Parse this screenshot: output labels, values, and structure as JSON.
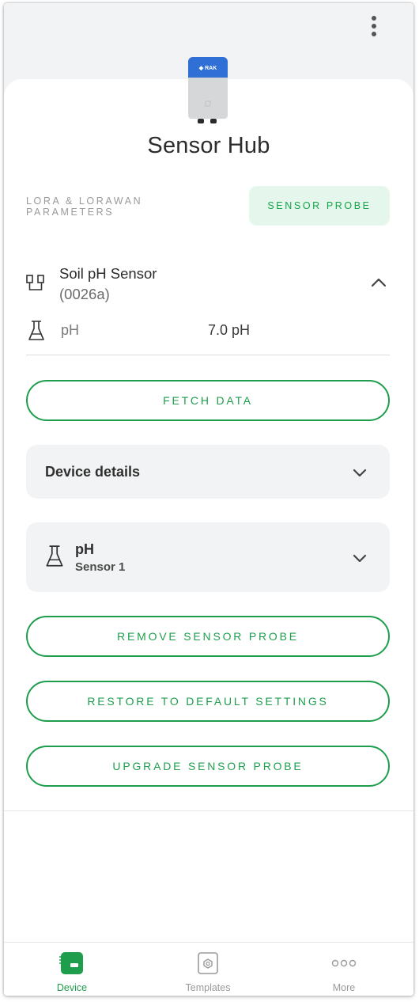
{
  "colors": {
    "accent": "#1e9e4d",
    "tab_active_bg": "#e5f6ec",
    "card_bg": "#f2f3f4",
    "inactive": "#9a9a9a"
  },
  "header": {
    "title": "Sensor Hub",
    "menu_icon": "more-vertical-icon",
    "device_image": "rak-device-icon"
  },
  "tabs": [
    {
      "label": "LORA & LORAWAN PARAMETERS",
      "active": false
    },
    {
      "label": "SENSOR PROBE",
      "active": true
    }
  ],
  "sensor": {
    "name": "Soil pH Sensor",
    "id": "(0026a)",
    "icon": "probe-connector-icon",
    "expanded": true,
    "readings": [
      {
        "icon": "flask-icon",
        "label": "pH",
        "value": "7.0 pH"
      }
    ]
  },
  "actions": {
    "fetch": "FETCH DATA",
    "remove": "REMOVE SENSOR PROBE",
    "restore": "RESTORE TO DEFAULT SETTINGS",
    "upgrade": "UPGRADE SENSOR PROBE"
  },
  "cards": {
    "device_details": {
      "label": "Device details",
      "icon": "chevron-down-icon"
    },
    "ph": {
      "label": "pH",
      "sublabel": "Sensor 1",
      "icon": "flask-icon"
    }
  },
  "bottom_nav": [
    {
      "label": "Device",
      "icon": "device-icon",
      "active": true
    },
    {
      "label": "Templates",
      "icon": "templates-icon",
      "active": false
    },
    {
      "label": "More",
      "icon": "more-horizontal-icon",
      "active": false
    }
  ]
}
